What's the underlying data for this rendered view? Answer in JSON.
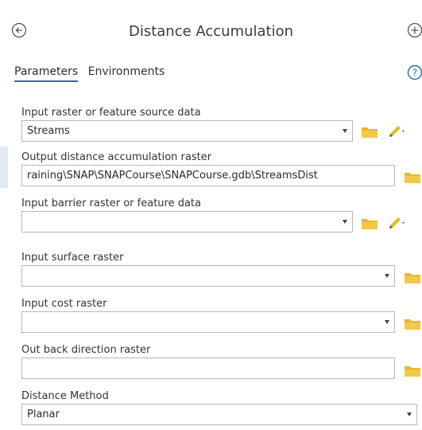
{
  "header": {
    "title": "Distance Accumulation",
    "back_icon": "back-arrow-circle-icon",
    "add_icon": "add-plus-circle-icon"
  },
  "tabs": [
    {
      "label": "Parameters",
      "active": true
    },
    {
      "label": "Environments",
      "active": false
    }
  ],
  "help_icon": "help-question-icon",
  "params": {
    "input_source": {
      "label": "Input raster or feature source data",
      "value": "Streams"
    },
    "output_raster": {
      "label": "Output distance accumulation raster",
      "value": "raining\\SNAP\\SNAPCourse\\SNAPCourse.gdb\\StreamsDist"
    },
    "barrier": {
      "label": "Input barrier raster or feature data",
      "value": ""
    },
    "surface": {
      "label": "Input surface raster",
      "value": ""
    },
    "cost": {
      "label": "Input cost raster",
      "value": ""
    },
    "back_direction": {
      "label": "Out back direction raster",
      "value": ""
    },
    "distance_method": {
      "label": "Distance Method",
      "value": "Planar"
    }
  },
  "colors": {
    "accent": "#1f6fb5",
    "folder": "#e8b923",
    "pencil": "#e8b923"
  }
}
